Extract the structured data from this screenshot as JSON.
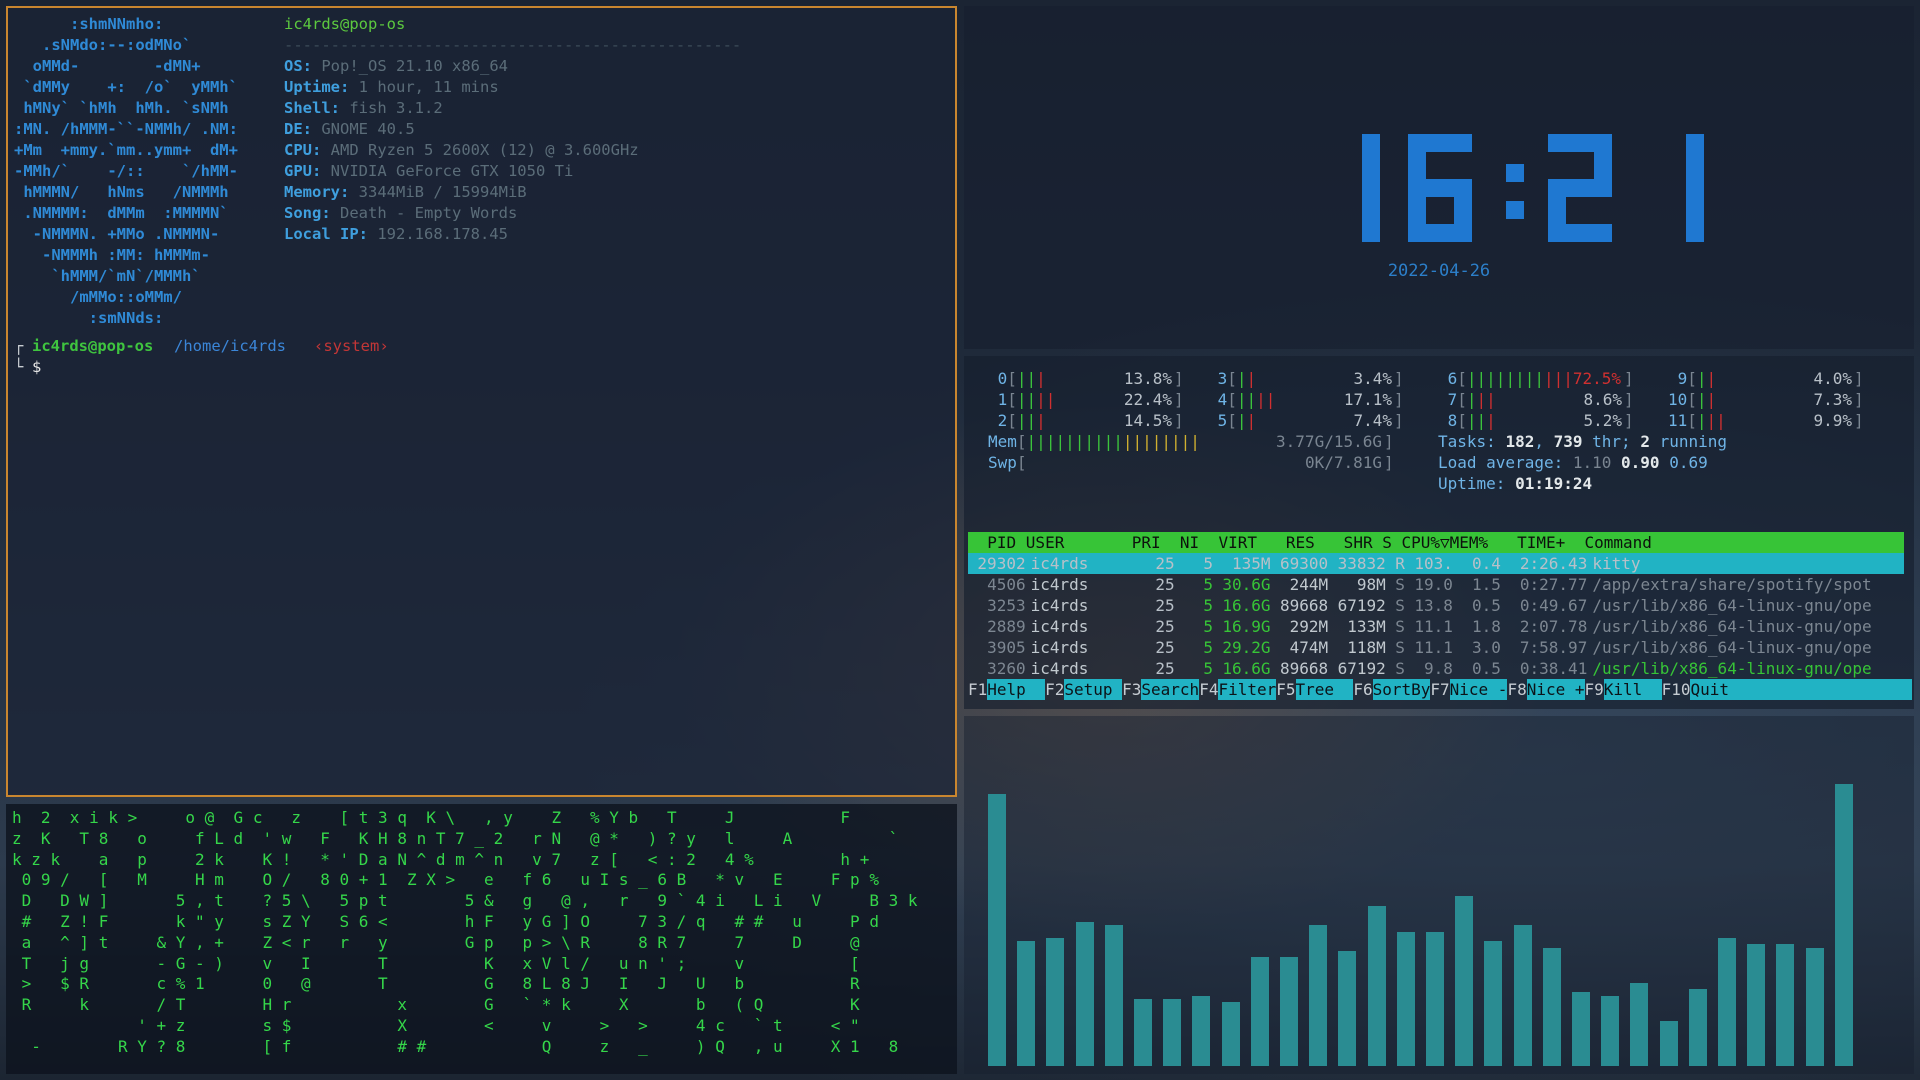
{
  "neofetch": {
    "logo_lines": [
      "      :shmNNmho:",
      "   .sNMdo:--:odMNo`",
      "  oMMd-        -dMN+",
      " `dMMy    +:  /o`  yMMh`",
      " hMNy` `hMh  hMh. `sNMh",
      ":MN. /hMMM-``-NMMh/ .NM:",
      "+Mm  +mmy.`mm..ymm+  dM+",
      "-MMh/`    -/::    `/hMM-",
      " hMMMN/   hNms   /NMMMh",
      " .NMMMM:  dMMm  :MMMMN`",
      "  -NMMMN. +MMo .NMMMN-",
      "   -NMMMh :MM: hMMMm-",
      "    `hMMM/`mN`/MMMh`",
      "      /mMMo::oMMm/",
      "        :smNNds:"
    ],
    "title": "ic4rds@pop-os",
    "separator": "-------------------------------------------------",
    "fields": [
      {
        "key": "OS",
        "value": "Pop!_OS 21.10 x86_64"
      },
      {
        "key": "Uptime",
        "value": "1 hour, 11 mins"
      },
      {
        "key": "Shell",
        "value": "fish 3.1.2"
      },
      {
        "key": "DE",
        "value": "GNOME 40.5"
      },
      {
        "key": "CPU",
        "value": "AMD Ryzen 5 2600X (12) @ 3.600GHz"
      },
      {
        "key": "GPU",
        "value": "NVIDIA GeForce GTX 1050 Ti"
      },
      {
        "key": "Memory",
        "value": "3344MiB / 15994MiB"
      },
      {
        "key": "Song",
        "value": "Death - Empty Words"
      },
      {
        "key": "Local IP",
        "value": "192.168.178.45"
      }
    ],
    "prompt": {
      "corner": "┌",
      "user": "ic4rds@pop-os",
      "path": "/home/ic4rds",
      "tag": "‹system›",
      "corner2": "└",
      "symbol": "$"
    }
  },
  "clock": {
    "time": "16:21",
    "date": "2022-04-26",
    "color": "#1f78d1"
  },
  "htop": {
    "cpus": [
      {
        "id": "0",
        "bars": "||",
        "red": "|",
        "pct": "13.8%"
      },
      {
        "id": "1",
        "bars": "||",
        "red": "||",
        "pct": "22.4%"
      },
      {
        "id": "2",
        "bars": "||",
        "red": "|",
        "pct": "14.5%"
      },
      {
        "id": "3",
        "bars": "|",
        "red": "|",
        "pct": "3.4%"
      },
      {
        "id": "4",
        "bars": "||",
        "red": "||",
        "pct": "17.1%"
      },
      {
        "id": "5",
        "bars": "|",
        "red": "|",
        "pct": "7.4%"
      },
      {
        "id": "6",
        "bars": "||||||||",
        "red": "|||72.5%",
        "pct": ""
      },
      {
        "id": "7",
        "bars": "|",
        "red": "||",
        "pct": "8.6%"
      },
      {
        "id": "8",
        "bars": "||",
        "red": "|",
        "pct": "5.2%"
      },
      {
        "id": "9",
        "bars": "|",
        "red": "|",
        "pct": "4.0%"
      },
      {
        "id": "10",
        "bars": "|",
        "red": "|",
        "pct": "7.3%"
      },
      {
        "id": "11",
        "bars": "|",
        "red": "||",
        "pct": "9.9%"
      }
    ],
    "mem": {
      "label": "Mem",
      "green": "||||||||||",
      "yellow": "||||||||",
      "value": "3.77G/15.6G"
    },
    "swp": {
      "label": "Swp",
      "value": "0K/7.81G"
    },
    "tasks": {
      "label": "Tasks:",
      "count": "182",
      "thr": "739",
      "thr_label": "thr;",
      "running": "2",
      "running_label": "running"
    },
    "load": {
      "label": "Load average:",
      "a": "1.10",
      "b": "0.90",
      "c": "0.69"
    },
    "uptime": {
      "label": "Uptime:",
      "value": "01:19:24"
    },
    "columns": "  PID USER       PRI  NI  VIRT   RES   SHR S CPU%▽MEM%   TIME+  Command",
    "processes": [
      {
        "pid": "29302",
        "user": "ic4rds",
        "pri": "25",
        "ni": "5",
        "virt": "135M",
        "res": "69300",
        "shr": "33832",
        "s": "R",
        "cpu": "103.",
        "mem": "0.4",
        "time": "2:26.43",
        "cmd": "kitty"
      },
      {
        "pid": "4506",
        "user": "ic4rds",
        "pri": "25",
        "ni": "5",
        "virt": "30.6G",
        "res": "244M",
        "shr": "98M",
        "s": "S",
        "cpu": "19.0",
        "mem": "1.5",
        "time": "0:27.77",
        "cmd": "/app/extra/share/spotify/spot"
      },
      {
        "pid": "3253",
        "user": "ic4rds",
        "pri": "25",
        "ni": "5",
        "virt": "16.6G",
        "res": "89668",
        "shr": "67192",
        "s": "S",
        "cpu": "13.8",
        "mem": "0.5",
        "time": "0:49.67",
        "cmd": "/usr/lib/x86_64-linux-gnu/ope"
      },
      {
        "pid": "2889",
        "user": "ic4rds",
        "pri": "25",
        "ni": "5",
        "virt": "16.9G",
        "res": "292M",
        "shr": "133M",
        "s": "S",
        "cpu": "11.1",
        "mem": "1.8",
        "time": "2:07.78",
        "cmd": "/usr/lib/x86_64-linux-gnu/ope"
      },
      {
        "pid": "3905",
        "user": "ic4rds",
        "pri": "25",
        "ni": "5",
        "virt": "29.2G",
        "res": "474M",
        "shr": "118M",
        "s": "S",
        "cpu": "11.1",
        "mem": "3.0",
        "time": "7:58.97",
        "cmd": "/usr/lib/x86_64-linux-gnu/ope"
      },
      {
        "pid": "3260",
        "user": "ic4rds",
        "pri": "25",
        "ni": "5",
        "virt": "16.6G",
        "res": "89668",
        "shr": "67192",
        "s": "S",
        "cpu": "9.8",
        "mem": "0.5",
        "time": "0:38.41",
        "cmd": "/usr/lib/x86_64-linux-gnu/ope"
      }
    ],
    "function_keys": [
      {
        "key": "F1",
        "label": "Help  "
      },
      {
        "key": "F2",
        "label": "Setup "
      },
      {
        "key": "F3",
        "label": "Search"
      },
      {
        "key": "F4",
        "label": "Filter"
      },
      {
        "key": "F5",
        "label": "Tree  "
      },
      {
        "key": "F6",
        "label": "SortBy"
      },
      {
        "key": "F7",
        "label": "Nice -"
      },
      {
        "key": "F8",
        "label": "Nice +"
      },
      {
        "key": "F9",
        "label": "Kill  "
      },
      {
        "key": "F10",
        "label": "Quit                   "
      }
    ]
  },
  "matrix": {
    "lines": [
      "h  2  x i k >     o @  G c   z    [ t 3 q  K \\   , y    Z   % Y b   T     J           F",
      "z  K   T 8   o     f L d  ' w   F   K H 8 n T 7 _ 2   r N   @ *   ) ? y   l     A          `",
      "k z k    a   p     2 k    K !   * ' D a N ^ d m ^ n   v 7   z [   < : 2   4 %         h +",
      " 0 9 /   [   M     H m    O /   8 0 + 1  Z X >   e   f 6   u I s _ 6 B   * v   E     F p %",
      " D   D W ]       5 , t    ? 5 \\   5 p t        5 &   g   @ ,   r   9 ` 4 i   L i   V     B 3 k",
      " #   Z ! F       k \" y    s Z Y   S 6 <        h F   y G ] O     7 3 / q   # #   u     P d",
      " a   ^ ] t     & Y , +    Z < r   r   y        G p   p > \\ R     8 R 7     7     D     @",
      " T   j g       - G - )    v   I       T          K   x V l /   u n ' ;     v           [",
      " >   $ R       c % 1      0   @       T          G   8 L 8 J   I   J   U   b           R",
      " R     k       / T        H r           x        G   ` * k     X       b   ( Q         K",
      "             ' + z        s $           X        <     v     >   >     4 c   ` t     < \"",
      "  -        R Y ? 8        [ f           # #            Q     z   _     ) Q   , u     X 1   8"
    ]
  },
  "cava": {
    "color": "#2a8c92",
    "levels": [
      0.85,
      0.39,
      0.4,
      0.45,
      0.44,
      0.21,
      0.21,
      0.22,
      0.2,
      0.34,
      0.34,
      0.44,
      0.36,
      0.5,
      0.42,
      0.42,
      0.53,
      0.39,
      0.44,
      0.37,
      0.23,
      0.22,
      0.26,
      0.14,
      0.24,
      0.4,
      0.38,
      0.38,
      0.37,
      0.88
    ]
  }
}
